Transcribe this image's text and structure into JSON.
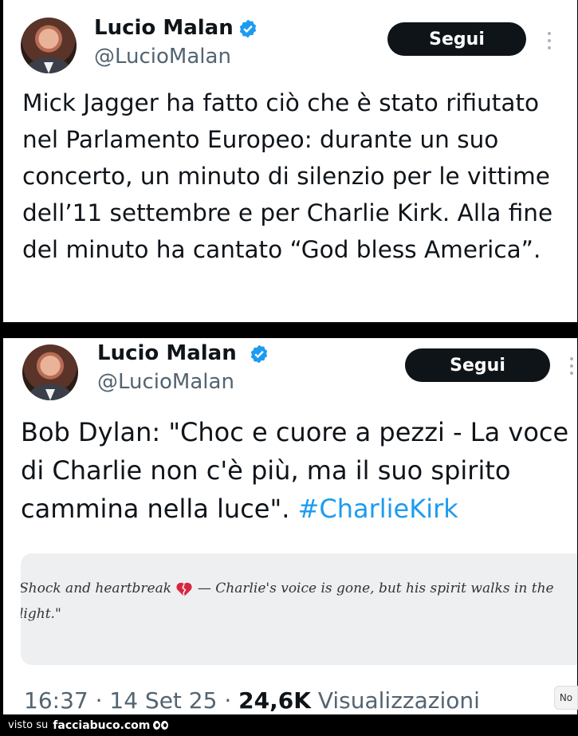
{
  "tweet1": {
    "author_name": "Lucio Malan",
    "handle": "@LucioMalan",
    "follow_label": "Segui",
    "text": "Mick Jagger ha fatto ciò che è stato rifiutato nel Parlamento Europeo: durante un suo concerto, un minuto di silenzio per le vittime dell’11 settembre e per Charlie Kirk. Alla fine del minuto ha cantato “God bless America”."
  },
  "tweet2": {
    "author_name": "Lucio Malan",
    "handle": "@LucioMalan",
    "follow_label": "Segui",
    "text": "Bob Dylan: \"Choc e cuore a pezzi - La voce di Charlie non c'è più, ma il suo spirito cammina nella luce\". ",
    "hashtag": "#CharlieKirk",
    "quote_part1": "Shock and heartbreak",
    "quote_part2": " — Charlie's voice is gone, but his spirit walks in the",
    "quote_line2": "light.\"",
    "time": "16:37 · 14 Set 25 · ",
    "views_count": "24,6K",
    "views_label": " Visualizzazioni"
  },
  "side_tab_label": "No",
  "footer": {
    "prefix": "visto su",
    "site": "facciabuco.com"
  },
  "colors": {
    "verified_blue": "#1d9bf0",
    "hashtag_blue": "#1d9bf0",
    "follow_bg": "#0f1419",
    "heart_red": "#d7263d"
  },
  "icons": [
    "verified-badge-icon",
    "more-options-icon",
    "broken-heart-icon",
    "eyes-logo-icon"
  ]
}
